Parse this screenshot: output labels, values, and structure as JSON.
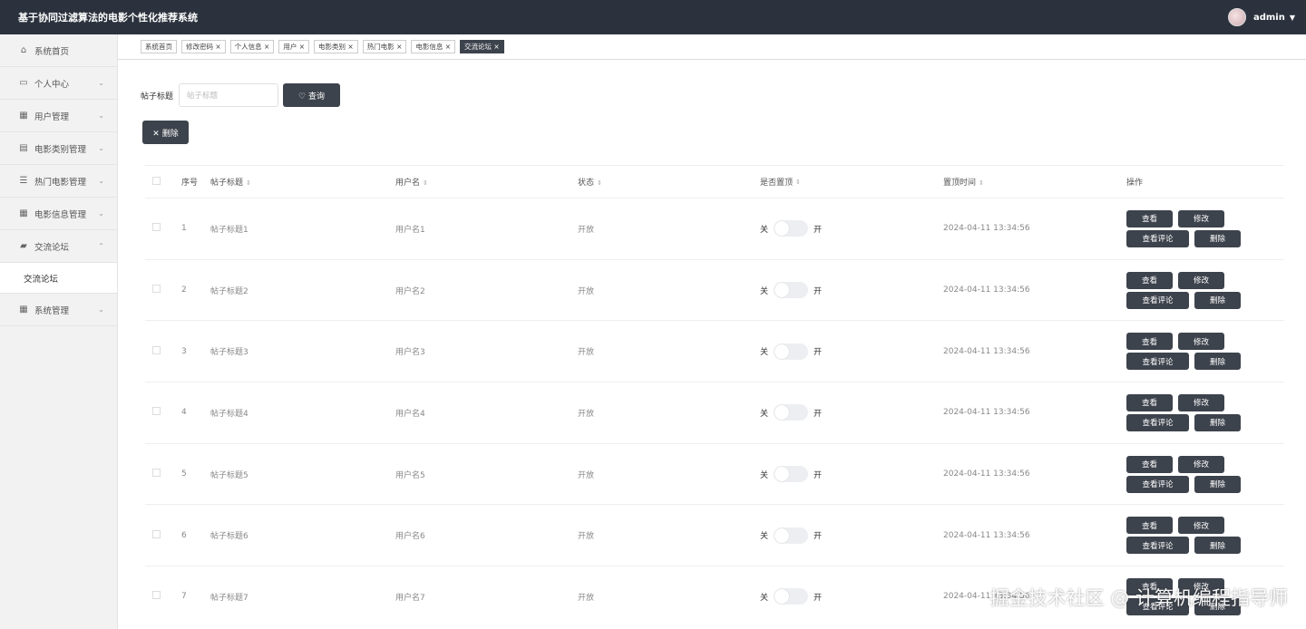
{
  "header": {
    "title": "基于协同过滤算法的电影个性化推荐系统",
    "username": "admin"
  },
  "sidebar": {
    "items": [
      {
        "label": "系统首页",
        "icon": "home-icon",
        "glyph": "⌂"
      },
      {
        "label": "个人中心",
        "icon": "id-card-icon",
        "glyph": "▭",
        "chevron": "⌄"
      },
      {
        "label": "用户管理",
        "icon": "grid-icon",
        "glyph": "▦",
        "chevron": "⌄"
      },
      {
        "label": "电影类别管理",
        "icon": "clipboard-icon",
        "glyph": "▤",
        "chevron": "⌄"
      },
      {
        "label": "热门电影管理",
        "icon": "sliders-icon",
        "glyph": "☰",
        "chevron": "⌄"
      },
      {
        "label": "电影信息管理",
        "icon": "apps-icon",
        "glyph": "▦",
        "chevron": "⌄"
      },
      {
        "label": "交流论坛",
        "icon": "chat-icon",
        "glyph": "▰",
        "chevron": "⌃"
      }
    ],
    "sub_item": "交流论坛",
    "last_item": {
      "label": "系统管理",
      "icon": "grid-icon",
      "glyph": "▦",
      "chevron": "⌄"
    }
  },
  "tabs": [
    {
      "label": "系统首页",
      "closable": false
    },
    {
      "label": "修改密码 ×",
      "closable": true
    },
    {
      "label": "个人信息 ×",
      "closable": true
    },
    {
      "label": "用户 ×",
      "closable": true
    },
    {
      "label": "电影类别 ×",
      "closable": true
    },
    {
      "label": "热门电影 ×",
      "closable": true
    },
    {
      "label": "电影信息 ×",
      "closable": true
    },
    {
      "label": "交流论坛 ×",
      "closable": true,
      "active": true
    }
  ],
  "search": {
    "label": "帖子标题",
    "placeholder": "帖子标题",
    "button": "♡ 查询"
  },
  "batch_delete": "✕ 删除",
  "table": {
    "headers": {
      "index": "序号",
      "title": "帖子标题",
      "user": "用户名",
      "status": "状态",
      "pinned": "是否置顶",
      "pin_time": "置顶时间",
      "ops": "操作"
    },
    "sort_glyph": "⇕",
    "switch_off": "关",
    "switch_on": "开",
    "op_labels": {
      "view": "查看",
      "edit": "修改",
      "comments": "查看评论",
      "delete": "删除"
    },
    "rows": [
      {
        "index": "1",
        "title": "帖子标题1",
        "user": "用户名1",
        "status": "开放",
        "time": "2024-04-11 13:34:56",
        "pinned": false
      },
      {
        "index": "2",
        "title": "帖子标题2",
        "user": "用户名2",
        "status": "开放",
        "time": "2024-04-11 13:34:56",
        "pinned": false
      },
      {
        "index": "3",
        "title": "帖子标题3",
        "user": "用户名3",
        "status": "开放",
        "time": "2024-04-11 13:34:56",
        "pinned": false
      },
      {
        "index": "4",
        "title": "帖子标题4",
        "user": "用户名4",
        "status": "开放",
        "time": "2024-04-11 13:34:56",
        "pinned": false
      },
      {
        "index": "5",
        "title": "帖子标题5",
        "user": "用户名5",
        "status": "开放",
        "time": "2024-04-11 13:34:56",
        "pinned": false
      },
      {
        "index": "6",
        "title": "帖子标题6",
        "user": "用户名6",
        "status": "开放",
        "time": "2024-04-11 13:34:56",
        "pinned": false
      },
      {
        "index": "7",
        "title": "帖子标题7",
        "user": "用户名7",
        "status": "开放",
        "time": "2024-04-11 13:34:56",
        "pinned": false
      }
    ]
  },
  "watermark": "掘金技术社区 @ 计算机编程指导师",
  "colors": {
    "topbar": "#2b323d",
    "button": "#3d434c",
    "sidebar": "#f2f2f2"
  }
}
